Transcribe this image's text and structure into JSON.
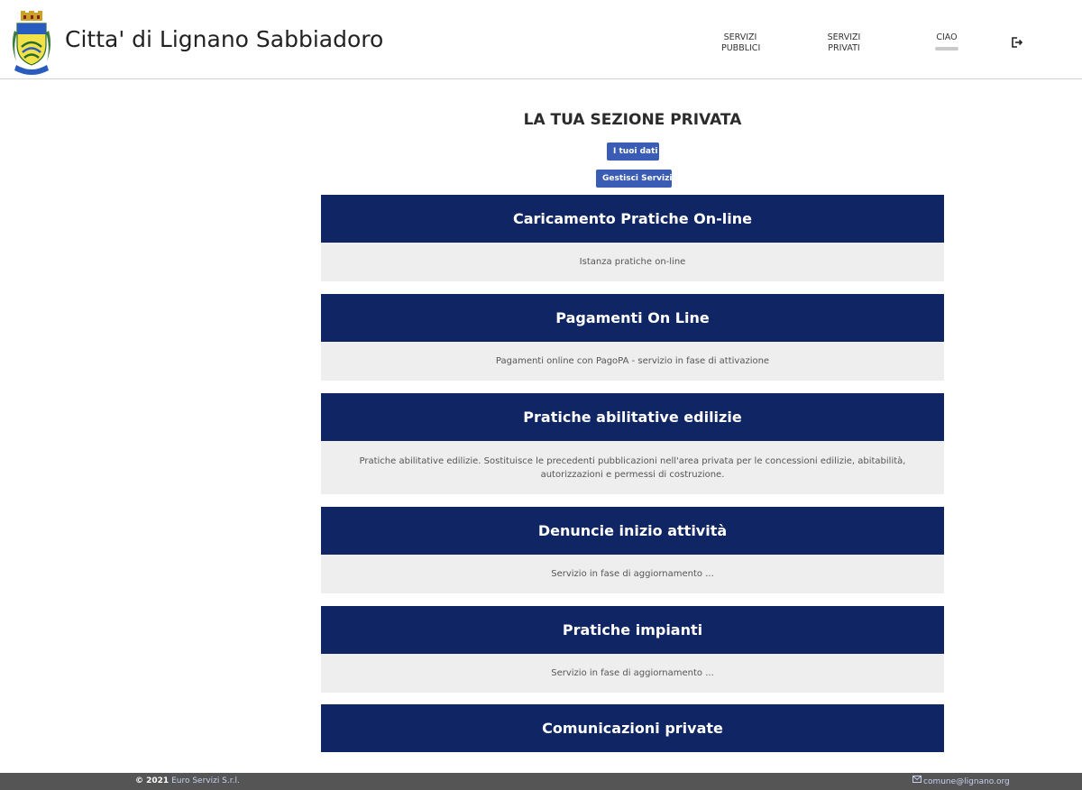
{
  "header": {
    "site_title": "Citta' di Lignano Sabbiadoro",
    "logo_icon": "coat-of-arms-icon",
    "nav": [
      {
        "line1": "SERVIZI",
        "line2": "PUBBLICI"
      },
      {
        "line1": "SERVIZI",
        "line2": "PRIVATI"
      }
    ],
    "greeting": "CIAO",
    "logout_icon": "logout-icon"
  },
  "main": {
    "title": "LA TUA SEZIONE PRIVATA",
    "button_dati": "I tuoi dati",
    "button_servizi": "Gestisci Servizi",
    "cards": [
      {
        "title": "Caricamento Pratiche On-line",
        "description": "Istanza pratiche on-line"
      },
      {
        "title": "Pagamenti On Line",
        "description": "Pagamenti online con PagoPA - servizio in fase di attivazione"
      },
      {
        "title": "Pratiche abilitative edilizie",
        "description": "Pratiche abilitative edilizie. Sostituisce le precedenti pubblicazioni nell'area privata per le concessioni edilizie, abitabilità, autorizzazioni e permessi di costruzione."
      },
      {
        "title": "Denuncie inizio attività",
        "description": "Servizio in fase di aggiornamento ..."
      },
      {
        "title": "Pratiche impianti",
        "description": "Servizio in fase di aggiornamento ..."
      },
      {
        "title": "Comunicazioni private"
      }
    ]
  },
  "footer": {
    "copyright_year": "© 2021",
    "company": "Euro Servizi S.r.l.",
    "email": "comune@lignano.org",
    "email_icon": "mail-icon"
  },
  "colors": {
    "card_header": "#102664",
    "button": "#3a5cb4",
    "card_body": "#eeeeee",
    "footer": "#555555"
  }
}
